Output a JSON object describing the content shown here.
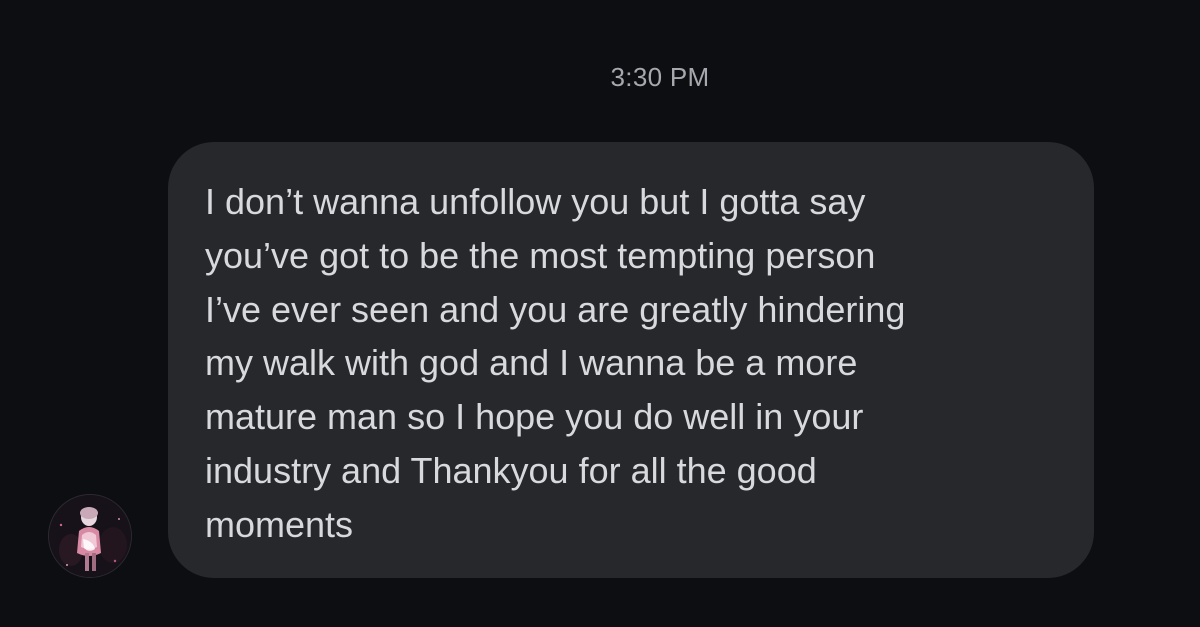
{
  "conversation": {
    "timestamp": "3:30 PM",
    "messages": [
      {
        "direction": "incoming",
        "text": "I don’t wanna unfollow you but I gotta say\nyou’ve got to be the most tempting person\nI’ve ever seen and you are greatly hindering\nmy walk with god and I wanna be a more\nmature man so I hope you do well in your\nindustry and Thankyou for all the good\nmoments"
      }
    ]
  },
  "colors": {
    "background": "#0d0e12",
    "bubble": "#26282c",
    "text": "#d8d9dc",
    "timestamp": "#a6a8ad"
  }
}
